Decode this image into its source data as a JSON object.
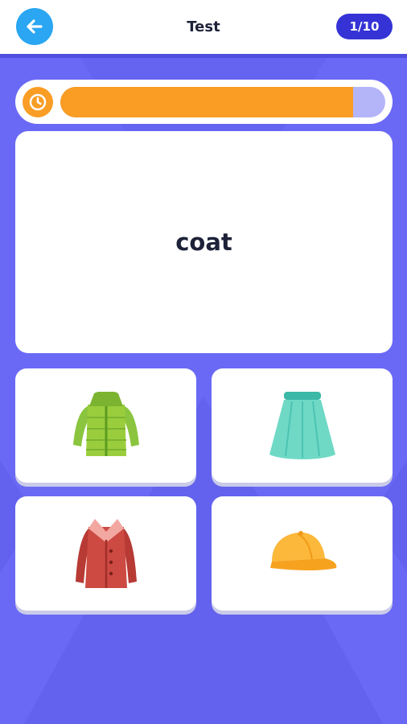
{
  "header": {
    "back_icon": "arrow-left-icon",
    "title": "Test",
    "progress": "1/10"
  },
  "timer": {
    "icon": "clock-icon",
    "remaining_fraction": 0.9
  },
  "question": {
    "word": "coat"
  },
  "options": [
    {
      "icon": "green-puffer-jacket-icon"
    },
    {
      "icon": "teal-skirt-icon"
    },
    {
      "icon": "red-coat-icon"
    },
    {
      "icon": "yellow-cap-icon"
    }
  ],
  "colors": {
    "background": "#6A69F5",
    "header_accent": "#3533D6",
    "back_button": "#2AA6F2",
    "timer_fill": "#F99D25",
    "timer_track": "#B4B4F9"
  }
}
